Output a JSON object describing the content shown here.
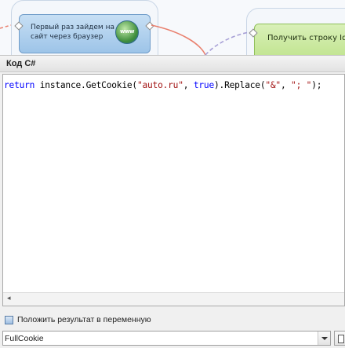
{
  "diagram": {
    "browser_node_label": "Первый раз зайдем на сайт через браузер",
    "browser_icon_text": "www",
    "next_node_label": "Получить строку Id объявлений"
  },
  "panel": {
    "title": "Код C#"
  },
  "editor": {
    "tokens": {
      "kw_return": "return",
      "call_open": " instance.GetCookie(",
      "str_site": "\"auto.ru\"",
      "comma1": ", ",
      "kw_true": "true",
      "replace_open": ").Replace(",
      "str_amp": "\"&\"",
      "comma2": ", ",
      "str_sep": "\"; \"",
      "close": ");"
    }
  },
  "save_option": {
    "label": "Положить результат в переменную"
  },
  "variable": {
    "selected": "FullCookie"
  }
}
